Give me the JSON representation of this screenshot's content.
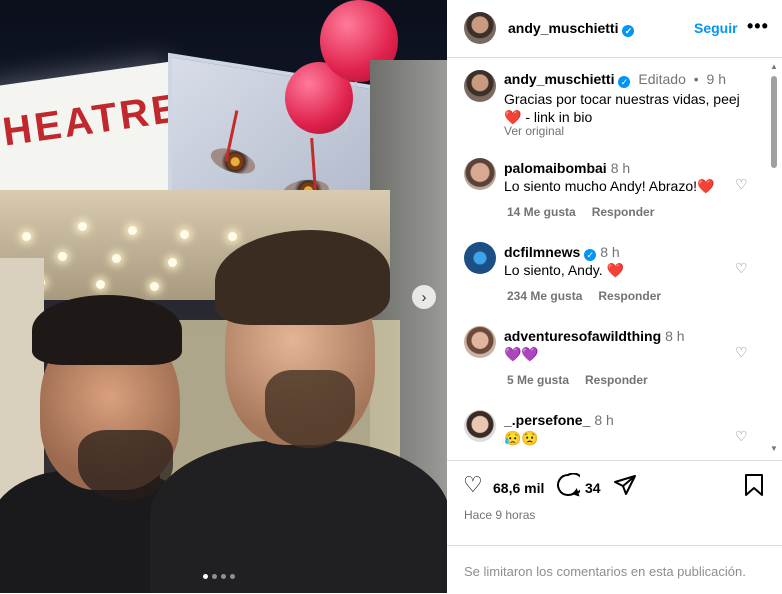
{
  "media": {
    "theatre_sign": "HEATRE",
    "next_icon": "chevron-right-icon",
    "carousel_count": 4,
    "carousel_active": 0
  },
  "header": {
    "username": "andy_muschietti",
    "follow_label": "Seguir",
    "more_label": "•••"
  },
  "caption": {
    "username": "andy_muschietti",
    "edited": "Editado",
    "separator": "•",
    "time": "9 h",
    "text_line1": "Gracias por tocar nuestras vidas, peej",
    "text_line2_emoji": "❤️",
    "text_line2": " - link in bio",
    "see_original": "Ver original"
  },
  "comments": [
    {
      "username": "palomaibombai",
      "time": "8 h",
      "text": "Lo siento mucho Andy! Abrazo!",
      "emoji": "❤️",
      "likes": "14 Me gusta",
      "reply": "Responder",
      "verified": false
    },
    {
      "username": "dcfilmnews",
      "time": "8 h",
      "text": "Lo siento, Andy. ",
      "emoji": "❤️",
      "likes": "234 Me gusta",
      "reply": "Responder",
      "verified": true
    },
    {
      "username": "adventuresofawildthing",
      "time": "8 h",
      "text": "",
      "emoji": "💜💜",
      "likes": "5 Me gusta",
      "reply": "Responder",
      "verified": false
    },
    {
      "username": "_.persefone_",
      "time": "8 h",
      "text": "",
      "emoji": "😥😟",
      "likes": "",
      "reply": "",
      "verified": false
    }
  ],
  "actions": {
    "likes_count": "68,6 mil",
    "comments_count": "34",
    "posted_ago": "Hace 9 horas"
  },
  "footer": {
    "limited_text": "Se limitaron los comentarios en esta publicación."
  },
  "colors": {
    "accent": "#0095f6",
    "muted": "#737373",
    "heart": "#e0245e"
  }
}
